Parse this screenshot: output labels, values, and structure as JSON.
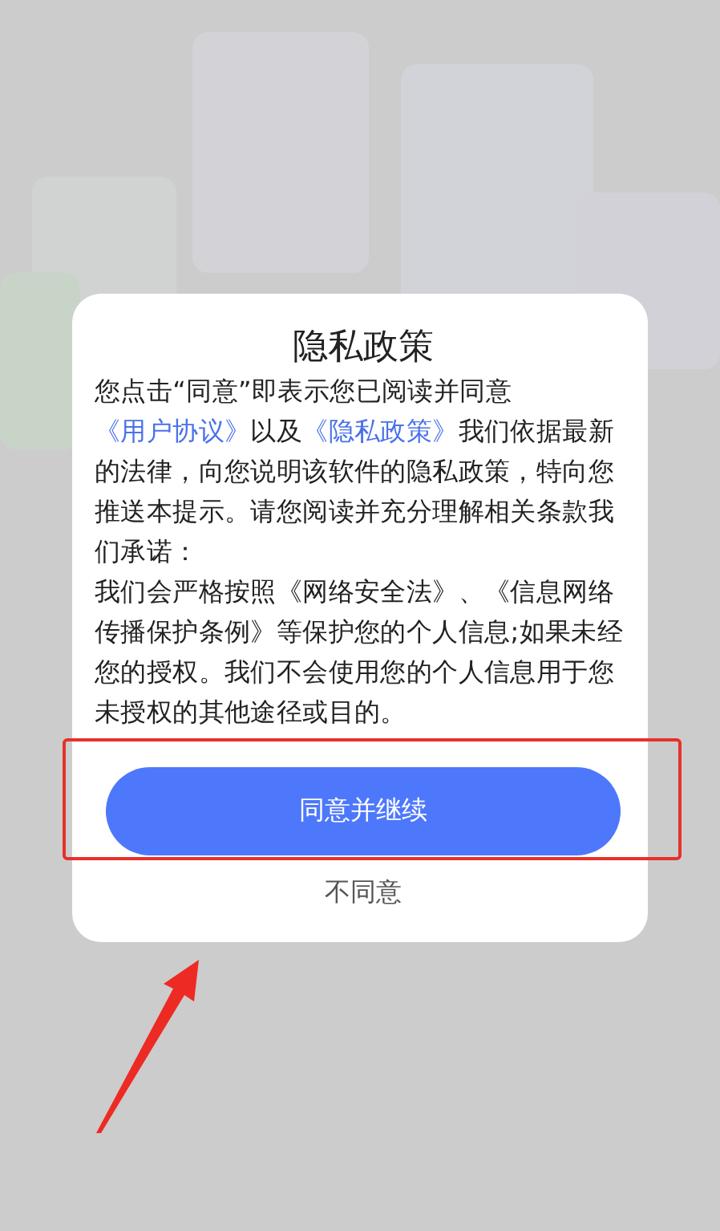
{
  "dialog": {
    "title": "隐私政策",
    "intro": [
      {
        "kind": "text",
        "text": "您点击“同意”即表示您已阅读并同意"
      },
      {
        "kind": "link",
        "text": "《用户协议》"
      },
      {
        "kind": "text",
        "text": "以及"
      },
      {
        "kind": "link",
        "text": "《隐私政策》"
      },
      {
        "kind": "text",
        "text": "我们依据最新的法律，向您说明该软件的隐私政策，特向您推送本提示。请您阅读并充分理解相关条款我们承诺："
      }
    ],
    "promise": "我们会严格按照《网络安全法》、《信息网络传播保护条例》等保护您的个人信息;如果未经您的授权。我们不会使用您的个人信息用于您未授权的其他途径或目的。",
    "agree_button": "同意并继续",
    "decline_link": "不同意"
  }
}
